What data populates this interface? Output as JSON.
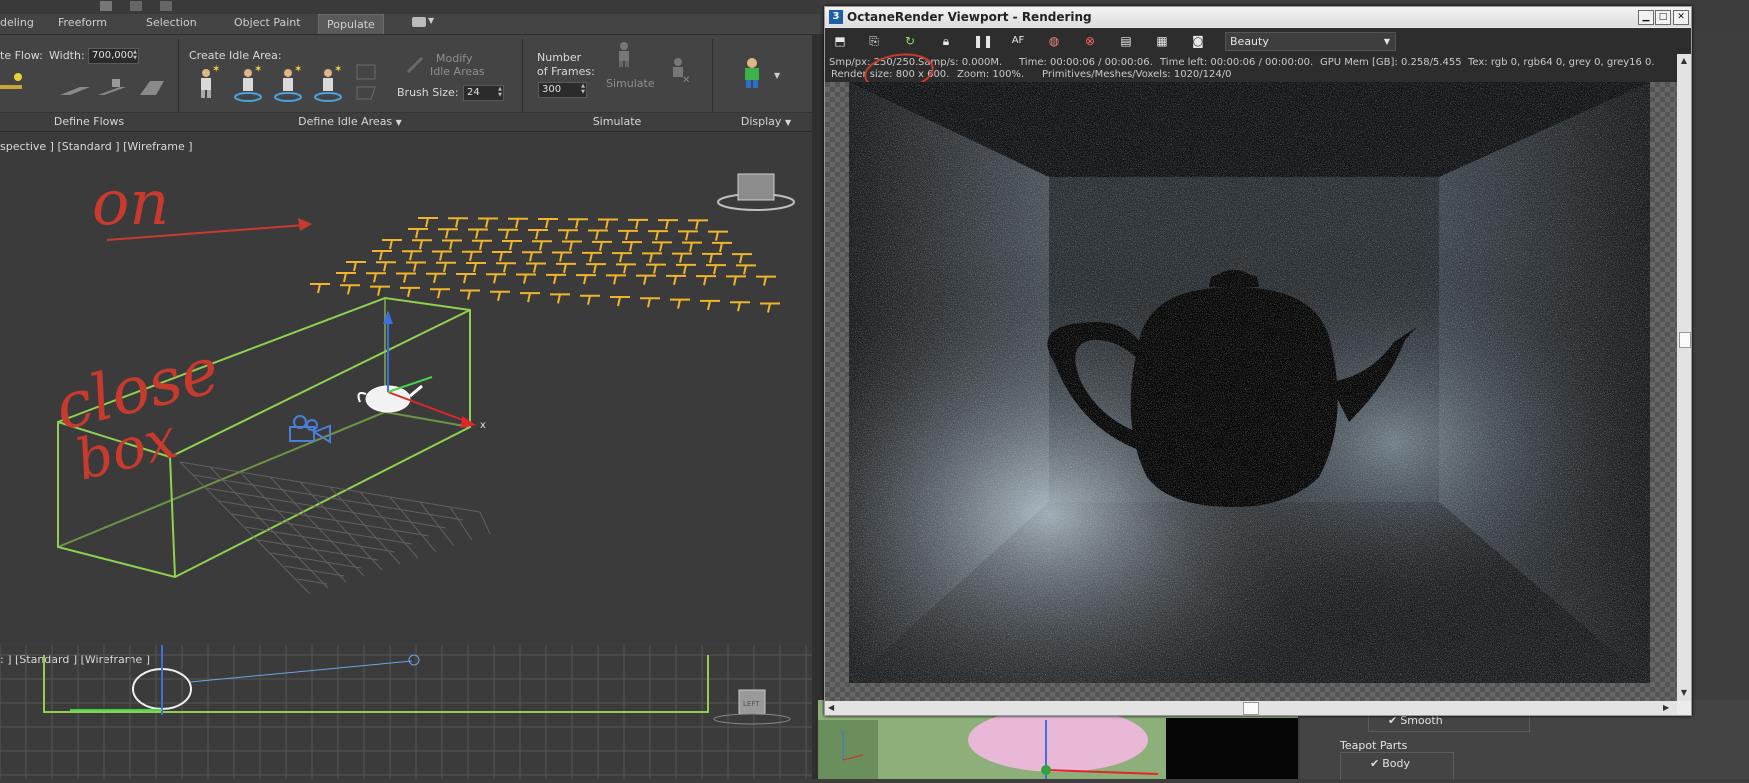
{
  "ribbon": {
    "tabs": [
      "deling",
      "Freeform",
      "Selection",
      "Object Paint",
      "Populate"
    ],
    "flow_label": "te Flow:",
    "width_label": "Width:",
    "width_value": "700,000",
    "create_idle_label": "Create Idle Area:",
    "modify_idle_label1": "Modify",
    "modify_idle_label2": "Idle Areas",
    "brush_size_label": "Brush Size:",
    "brush_size_value": "24",
    "frames_label1": "Number",
    "frames_label2": "of Frames:",
    "frames_value": "300",
    "simulate_label": "Simulate",
    "panel_define_flows": "Define Flows",
    "panel_define_idle": "Define Idle Areas",
    "panel_simulate": "Simulate",
    "panel_display": "Display"
  },
  "viewports": {
    "top_label": "spective ] [Standard ] [Wireframe ]",
    "bottom_label": ": ] [Standard ] [Wireframe ]",
    "left_cube_label": "LEFT"
  },
  "annotations": {
    "on": "on",
    "close": "close",
    "box": "box"
  },
  "octane": {
    "app_icon": "3",
    "title": "OctaneRender Viewport - Rendering",
    "pass_select": "Beauty",
    "stats_line1": {
      "smp_px": "Smp/px: 250/250.",
      "samp_s": "Samp/s: 0.000M.",
      "time": "Time: 00:00:06 / 00:00:06.",
      "time_left": "Time left: 00:00:06 / 00:00:00.",
      "gpu_mem": "GPU Mem [GB]: 0.258/5.455",
      "tex": "Tex: rgb 0, rgb64 0, grey 0, grey16 0."
    },
    "stats_line2": {
      "render_size": "Render size: 800 x 600.",
      "zoom": "Zoom: 100%.",
      "primitives": "Primitives/Meshes/Voxels: 1020/124/0"
    }
  },
  "properties": {
    "smooth": "Smooth",
    "teapot_parts": "Teapot Parts",
    "body": "Body"
  },
  "colors": {
    "annotation_red": "#c93a2e",
    "flow_yellow": "#f0b52a",
    "box_green": "#8fd14f"
  }
}
